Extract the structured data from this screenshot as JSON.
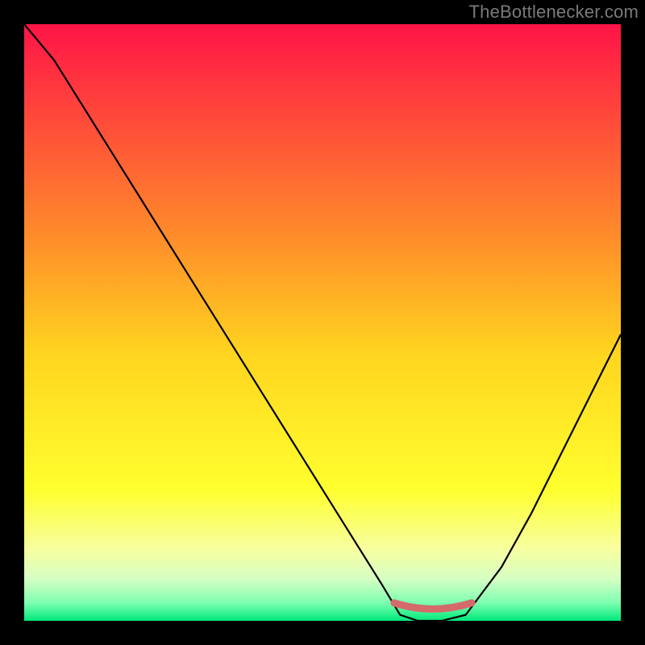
{
  "attribution": "TheBottlenecker.com",
  "chart_data": {
    "type": "line",
    "title": "",
    "xlabel": "",
    "ylabel": "",
    "xlim": [
      0,
      100
    ],
    "ylim": [
      0,
      100
    ],
    "x": [
      0,
      5,
      10,
      15,
      20,
      25,
      30,
      35,
      40,
      45,
      50,
      55,
      60,
      63,
      66,
      70,
      74,
      80,
      85,
      90,
      95,
      100
    ],
    "values": [
      100,
      94,
      86,
      78,
      70,
      62,
      54,
      46,
      38,
      30,
      22,
      14,
      6,
      1,
      0,
      0,
      1,
      9,
      18,
      28,
      38,
      48
    ],
    "optimal_zone": {
      "x_start": 62,
      "x_end": 75,
      "y": 1.5
    },
    "gradient_stops": [
      {
        "offset": 0.0,
        "color": "#ff1447"
      },
      {
        "offset": 0.35,
        "color": "#ff8a2b"
      },
      {
        "offset": 0.55,
        "color": "#ffd41f"
      },
      {
        "offset": 0.78,
        "color": "#ffff2e"
      },
      {
        "offset": 0.88,
        "color": "#f7ffa0"
      },
      {
        "offset": 0.93,
        "color": "#d6ffc4"
      },
      {
        "offset": 0.97,
        "color": "#7dffb0"
      },
      {
        "offset": 1.0,
        "color": "#00e87a"
      }
    ]
  }
}
